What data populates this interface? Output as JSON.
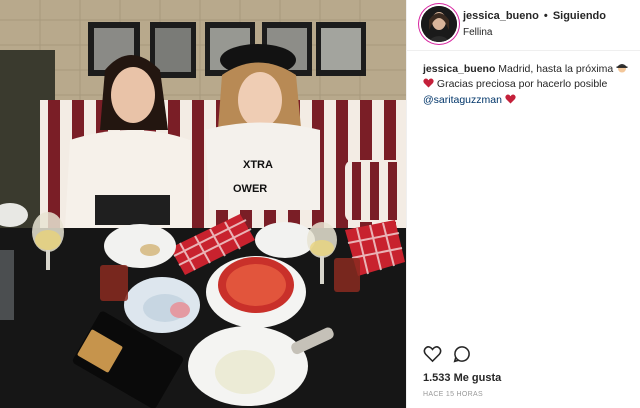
{
  "post": {
    "username": "jessica_bueno",
    "separator": "•",
    "follow_label": "Siguiendo",
    "location": "Fellina"
  },
  "caption": {
    "username": "jessica_bueno",
    "text_1": "Madrid, hasta la próxima",
    "text_2": "Gracias preciosa por hacerlo posible",
    "mention": "@saritaguzzman"
  },
  "photo_text": {
    "shirt_line_1": "XTRA",
    "shirt_line_2": "OWER"
  },
  "stats": {
    "likes": "1.533 Me gusta",
    "time": "HACE 15 HORAS"
  },
  "icons": {
    "like": "heart-outline-icon",
    "comment": "comment-bubble-icon"
  },
  "colors": {
    "mention": "#003569",
    "heart_emoji": "#c4203a"
  }
}
